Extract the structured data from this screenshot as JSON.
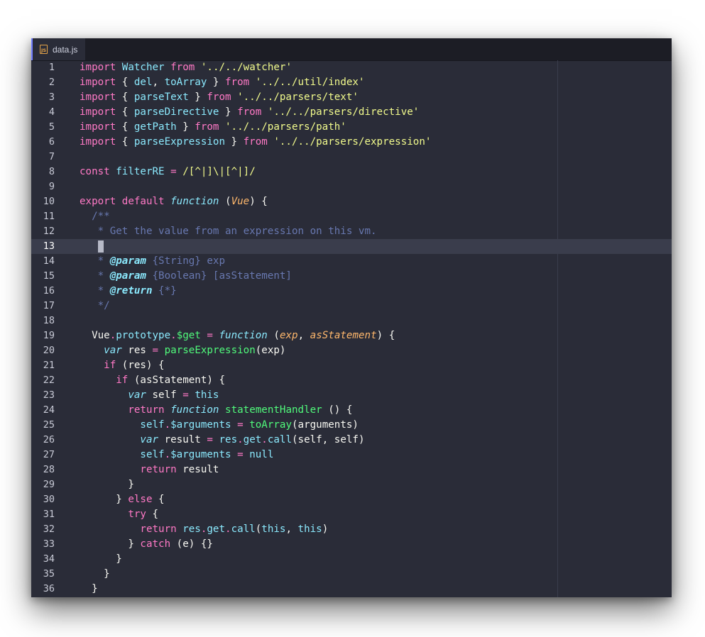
{
  "tab": {
    "icon_text": "JS",
    "icon": "js-file-icon",
    "filename": "data.js"
  },
  "colors": {
    "background": "#2a2c38",
    "keyword": "#ff79c6",
    "identifier": "#8be9fd",
    "string": "#f1fa8c",
    "comment": "#6878b0",
    "function": "#50fa7b",
    "parameter": "#ffb86c",
    "accent": "#6f7cff"
  },
  "editor": {
    "active_line": 13,
    "lines": [
      {
        "n": "1",
        "tokens": [
          [
            "kw",
            "import"
          ],
          [
            "pl",
            " "
          ],
          [
            "id",
            "Watcher"
          ],
          [
            "pl",
            " "
          ],
          [
            "kw",
            "from"
          ],
          [
            "pl",
            " "
          ],
          [
            "str",
            "'../../watcher'"
          ]
        ]
      },
      {
        "n": "2",
        "tokens": [
          [
            "kw",
            "import"
          ],
          [
            "pl",
            " { "
          ],
          [
            "id",
            "del"
          ],
          [
            "pl",
            ", "
          ],
          [
            "id",
            "toArray"
          ],
          [
            "pl",
            " } "
          ],
          [
            "kw",
            "from"
          ],
          [
            "pl",
            " "
          ],
          [
            "str",
            "'../../util/index'"
          ]
        ]
      },
      {
        "n": "3",
        "tokens": [
          [
            "kw",
            "import"
          ],
          [
            "pl",
            " { "
          ],
          [
            "id",
            "parseText"
          ],
          [
            "pl",
            " } "
          ],
          [
            "kw",
            "from"
          ],
          [
            "pl",
            " "
          ],
          [
            "str",
            "'../../parsers/text'"
          ]
        ]
      },
      {
        "n": "4",
        "tokens": [
          [
            "kw",
            "import"
          ],
          [
            "pl",
            " { "
          ],
          [
            "id",
            "parseDirective"
          ],
          [
            "pl",
            " } "
          ],
          [
            "kw",
            "from"
          ],
          [
            "pl",
            " "
          ],
          [
            "str",
            "'../../parsers/directive'"
          ]
        ]
      },
      {
        "n": "5",
        "tokens": [
          [
            "kw",
            "import"
          ],
          [
            "pl",
            " { "
          ],
          [
            "id",
            "getPath"
          ],
          [
            "pl",
            " } "
          ],
          [
            "kw",
            "from"
          ],
          [
            "pl",
            " "
          ],
          [
            "str",
            "'../../parsers/path'"
          ]
        ]
      },
      {
        "n": "6",
        "tokens": [
          [
            "kw",
            "import"
          ],
          [
            "pl",
            " { "
          ],
          [
            "id",
            "parseExpression"
          ],
          [
            "pl",
            " } "
          ],
          [
            "kw",
            "from"
          ],
          [
            "pl",
            " "
          ],
          [
            "str",
            "'../../parsers/expression'"
          ]
        ]
      },
      {
        "n": "7",
        "tokens": []
      },
      {
        "n": "8",
        "tokens": [
          [
            "kw",
            "const"
          ],
          [
            "pl",
            " "
          ],
          [
            "id",
            "filterRE"
          ],
          [
            "pl",
            " "
          ],
          [
            "kw",
            "="
          ],
          [
            "pl",
            " "
          ],
          [
            "re",
            "/[^|]\\|[^|]/"
          ]
        ]
      },
      {
        "n": "9",
        "tokens": []
      },
      {
        "n": "10",
        "tokens": [
          [
            "kw",
            "export"
          ],
          [
            "pl",
            " "
          ],
          [
            "kw",
            "default"
          ],
          [
            "pl",
            " "
          ],
          [
            "it",
            "function"
          ],
          [
            "pl",
            " ("
          ],
          [
            "par",
            "Vue"
          ],
          [
            "pl",
            ") {"
          ]
        ]
      },
      {
        "n": "11",
        "tokens": [
          [
            "pl",
            "  "
          ],
          [
            "cm",
            "/**"
          ]
        ]
      },
      {
        "n": "12",
        "tokens": [
          [
            "pl",
            "   "
          ],
          [
            "cm",
            "* Get the value from an expression on this vm."
          ]
        ]
      },
      {
        "n": "13",
        "tokens": [
          [
            "pl",
            "   "
          ],
          [
            "cursor",
            "*"
          ]
        ]
      },
      {
        "n": "14",
        "tokens": [
          [
            "pl",
            "   "
          ],
          [
            "cm",
            "* "
          ],
          [
            "doc",
            "@param"
          ],
          [
            "cm",
            " {String} exp"
          ]
        ]
      },
      {
        "n": "15",
        "tokens": [
          [
            "pl",
            "   "
          ],
          [
            "cm",
            "* "
          ],
          [
            "doc",
            "@param"
          ],
          [
            "cm",
            " {Boolean} [asStatement]"
          ]
        ]
      },
      {
        "n": "16",
        "tokens": [
          [
            "pl",
            "   "
          ],
          [
            "cm",
            "* "
          ],
          [
            "doc",
            "@return"
          ],
          [
            "cm",
            " {*}"
          ]
        ]
      },
      {
        "n": "17",
        "tokens": [
          [
            "pl",
            "   "
          ],
          [
            "cm",
            "*/"
          ]
        ]
      },
      {
        "n": "18",
        "tokens": []
      },
      {
        "n": "19",
        "tokens": [
          [
            "pl",
            "  "
          ],
          [
            "pl",
            "Vue"
          ],
          [
            "kw",
            "."
          ],
          [
            "id",
            "prototype"
          ],
          [
            "kw",
            "."
          ],
          [
            "fn",
            "$get"
          ],
          [
            "pl",
            " "
          ],
          [
            "kw",
            "="
          ],
          [
            "pl",
            " "
          ],
          [
            "it",
            "function"
          ],
          [
            "pl",
            " ("
          ],
          [
            "par",
            "exp"
          ],
          [
            "pl",
            ", "
          ],
          [
            "par",
            "asStatement"
          ],
          [
            "pl",
            ") {"
          ]
        ]
      },
      {
        "n": "20",
        "tokens": [
          [
            "pl",
            "    "
          ],
          [
            "it",
            "var"
          ],
          [
            "pl",
            " res "
          ],
          [
            "kw",
            "="
          ],
          [
            "pl",
            " "
          ],
          [
            "fn",
            "parseExpression"
          ],
          [
            "pl",
            "(exp)"
          ]
        ]
      },
      {
        "n": "21",
        "tokens": [
          [
            "pl",
            "    "
          ],
          [
            "kw",
            "if"
          ],
          [
            "pl",
            " (res) {"
          ]
        ]
      },
      {
        "n": "22",
        "tokens": [
          [
            "pl",
            "      "
          ],
          [
            "kw",
            "if"
          ],
          [
            "pl",
            " (asStatement) {"
          ]
        ]
      },
      {
        "n": "23",
        "tokens": [
          [
            "pl",
            "        "
          ],
          [
            "it",
            "var"
          ],
          [
            "pl",
            " self "
          ],
          [
            "kw",
            "="
          ],
          [
            "pl",
            " "
          ],
          [
            "id",
            "this"
          ]
        ]
      },
      {
        "n": "24",
        "tokens": [
          [
            "pl",
            "        "
          ],
          [
            "kw",
            "return"
          ],
          [
            "pl",
            " "
          ],
          [
            "it",
            "function"
          ],
          [
            "pl",
            " "
          ],
          [
            "fn",
            "statementHandler"
          ],
          [
            "pl",
            " () {"
          ]
        ]
      },
      {
        "n": "25",
        "tokens": [
          [
            "pl",
            "          "
          ],
          [
            "id",
            "self"
          ],
          [
            "kw",
            "."
          ],
          [
            "id",
            "$arguments"
          ],
          [
            "pl",
            " "
          ],
          [
            "kw",
            "="
          ],
          [
            "pl",
            " "
          ],
          [
            "fn",
            "toArray"
          ],
          [
            "pl",
            "(arguments)"
          ]
        ]
      },
      {
        "n": "26",
        "tokens": [
          [
            "pl",
            "          "
          ],
          [
            "it",
            "var"
          ],
          [
            "pl",
            " result "
          ],
          [
            "kw",
            "="
          ],
          [
            "pl",
            " "
          ],
          [
            "id",
            "res"
          ],
          [
            "kw",
            "."
          ],
          [
            "id",
            "get"
          ],
          [
            "kw",
            "."
          ],
          [
            "id",
            "call"
          ],
          [
            "pl",
            "(self, self)"
          ]
        ]
      },
      {
        "n": "27",
        "tokens": [
          [
            "pl",
            "          "
          ],
          [
            "id",
            "self"
          ],
          [
            "kw",
            "."
          ],
          [
            "id",
            "$arguments"
          ],
          [
            "pl",
            " "
          ],
          [
            "kw",
            "="
          ],
          [
            "pl",
            " "
          ],
          [
            "id",
            "null"
          ]
        ]
      },
      {
        "n": "28",
        "tokens": [
          [
            "pl",
            "          "
          ],
          [
            "kw",
            "return"
          ],
          [
            "pl",
            " result"
          ]
        ]
      },
      {
        "n": "29",
        "tokens": [
          [
            "pl",
            "        }"
          ]
        ]
      },
      {
        "n": "30",
        "tokens": [
          [
            "pl",
            "      } "
          ],
          [
            "kw",
            "else"
          ],
          [
            "pl",
            " {"
          ]
        ]
      },
      {
        "n": "31",
        "tokens": [
          [
            "pl",
            "        "
          ],
          [
            "kw",
            "try"
          ],
          [
            "pl",
            " {"
          ]
        ]
      },
      {
        "n": "32",
        "tokens": [
          [
            "pl",
            "          "
          ],
          [
            "kw",
            "return"
          ],
          [
            "pl",
            " "
          ],
          [
            "id",
            "res"
          ],
          [
            "kw",
            "."
          ],
          [
            "id",
            "get"
          ],
          [
            "kw",
            "."
          ],
          [
            "id",
            "call"
          ],
          [
            "pl",
            "("
          ],
          [
            "id",
            "this"
          ],
          [
            "pl",
            ", "
          ],
          [
            "id",
            "this"
          ],
          [
            "pl",
            ")"
          ]
        ]
      },
      {
        "n": "33",
        "tokens": [
          [
            "pl",
            "        } "
          ],
          [
            "kw",
            "catch"
          ],
          [
            "pl",
            " (e) {}"
          ]
        ]
      },
      {
        "n": "34",
        "tokens": [
          [
            "pl",
            "      }"
          ]
        ]
      },
      {
        "n": "35",
        "tokens": [
          [
            "pl",
            "    }"
          ]
        ]
      },
      {
        "n": "36",
        "tokens": [
          [
            "pl",
            "  }"
          ]
        ]
      }
    ]
  }
}
